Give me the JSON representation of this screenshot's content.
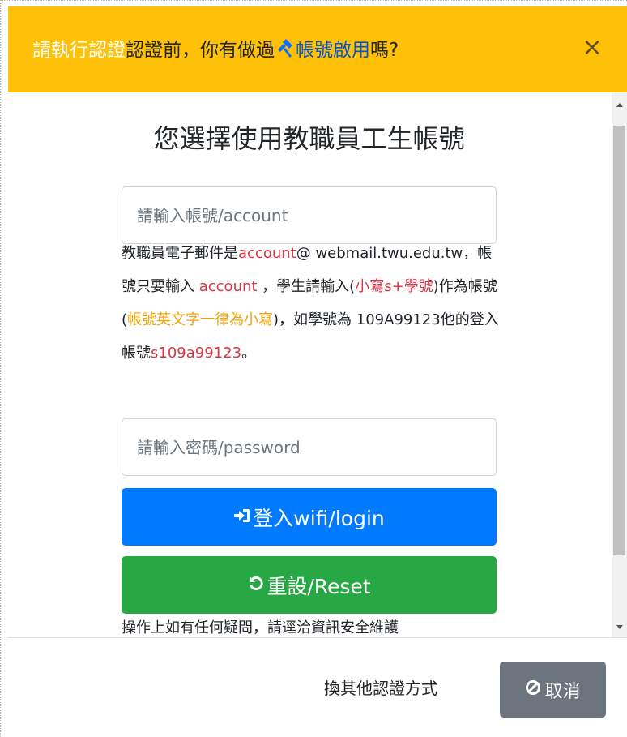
{
  "header": {
    "title_part1": "請執行認證",
    "title_part2": "認證前，你有做過",
    "title_link": "帳號啟用",
    "title_part3": "嗎?",
    "close_label": "×"
  },
  "form": {
    "title": "您選擇使用教職員工生帳號",
    "account_placeholder": "請輸入帳號/account",
    "password_placeholder": "請輸入密碼/password",
    "help": {
      "p1": "教職員電子郵件是",
      "account1": "account",
      "p2": "@ webmail.twu.edu.tw，帳號只要輸入 ",
      "account2": "account",
      "p3": " ，學生請輸入(",
      "lower_s": "小寫s+學號",
      "p4": ")作為帳號(",
      "all_lower": "帳號英文字一律為小寫",
      "p5": ")，如學號為 109A99123他的登入帳號",
      "example": "s109a99123",
      "p6": "。"
    },
    "login_label": "登入wifi/login",
    "reset_label": "重設/Reset",
    "footnote": "操作上如有任何疑問，請逕洽資訊安全維護"
  },
  "footer": {
    "other_method_label": "換其他認證方式",
    "cancel_label": "取消"
  },
  "colors": {
    "header_bg": "#ffc107",
    "primary": "#007bff",
    "success": "#28a745",
    "secondary": "#6c757d",
    "danger": "#dc3545",
    "warning_text": "#f0a30a"
  },
  "icons": {
    "header_link_icon": "hammer-icon",
    "login_icon": "sign-in-icon",
    "reset_icon": "undo-icon",
    "cancel_icon": "ban-icon"
  }
}
